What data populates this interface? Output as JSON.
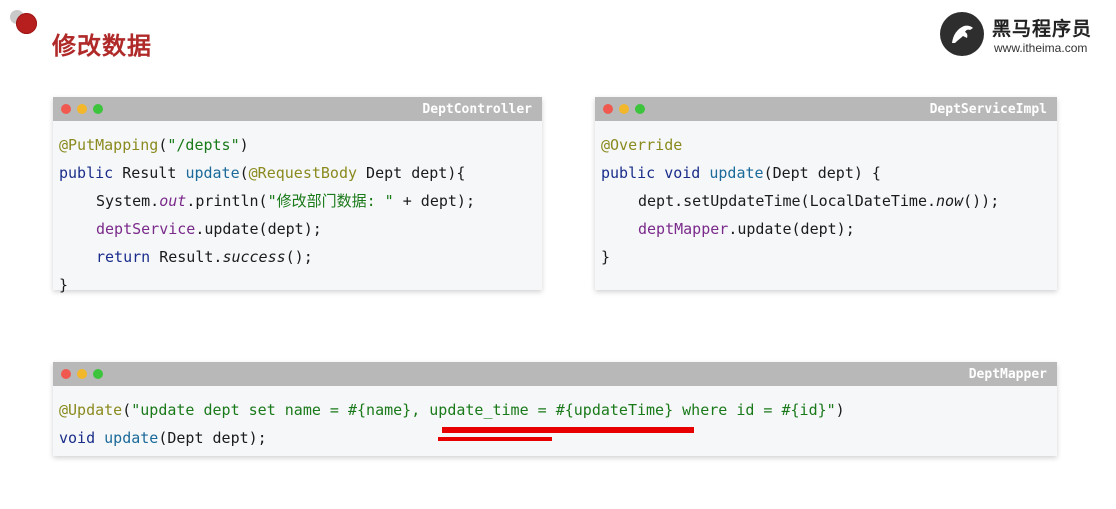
{
  "header": {
    "title": "修改数据",
    "logo_cn": "黑马程序员",
    "logo_url": "www.itheima.com"
  },
  "windows": {
    "controller": {
      "title": "DeptController",
      "lines": {
        "l1": {
          "a": "@PutMapping",
          "b": "(",
          "c": "\"/depts\"",
          "d": ")"
        },
        "l2": {
          "a": "public",
          "b": " Result ",
          "c": "update",
          "d": "(",
          "e": "@RequestBody",
          "f": " Dept dept){"
        },
        "l3": {
          "a": "System.",
          "b": "out",
          "c": ".println(",
          "d": "\"修改部门数据: \"",
          "e": " + dept);"
        },
        "l4": {
          "a": "deptService",
          "b": ".update(dept);"
        },
        "l5": {
          "a": "return",
          "b": " Result.",
          "c": "success",
          "d": "();"
        },
        "l6": {
          "a": "}"
        }
      }
    },
    "service": {
      "title": "DeptServiceImpl",
      "lines": {
        "l1": {
          "a": "@Override"
        },
        "l2": {
          "a": "public",
          "b": " ",
          "c": "void",
          "d": " ",
          "e": "update",
          "f": "(Dept dept) {"
        },
        "l3": {
          "a": "dept.setUpdateTime(LocalDateTime.",
          "b": "now",
          "c": "());"
        },
        "l4": {
          "a": "deptMapper",
          "b": ".update(dept);"
        },
        "l5": {
          "a": "}"
        }
      }
    },
    "mapper": {
      "title": "DeptMapper",
      "lines": {
        "l1": {
          "a": "@Update",
          "b": "(",
          "c": "\"update dept set name = #{name}, ",
          "d": "update_time = #{updateTime}",
          "e": " where id = #{id}\"",
          "f": ")"
        },
        "l2": {
          "a": "void",
          "b": " ",
          "c": "update",
          "d": "(Dept dept);"
        }
      }
    }
  },
  "colors": {
    "title_red": "#b02a2a",
    "highlight_red": "#e80000",
    "window_bar": "#b8b8b8"
  }
}
